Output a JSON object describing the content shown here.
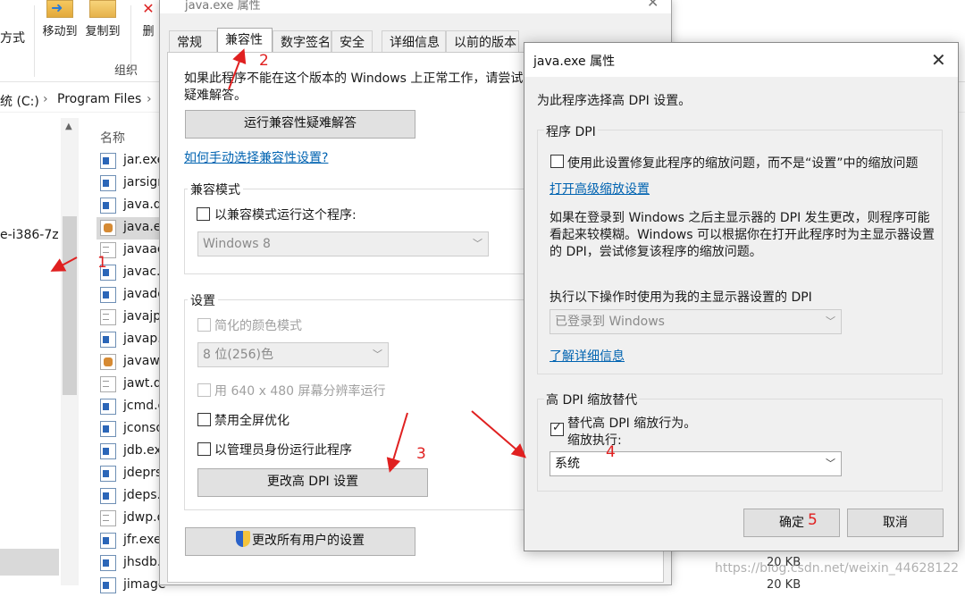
{
  "explorer": {
    "ribbon": {
      "partial_label": "方式",
      "move_to": "移动到",
      "copy_to": "复制到",
      "delete_partial": "删",
      "group": "组织"
    },
    "address": {
      "drive": "统 (C:)",
      "sep": "›",
      "folder": "Program Files",
      "sep2": "›"
    },
    "nav_partial": "e-i386-7z",
    "column_name": "名称",
    "files": [
      {
        "name": "jar.exe",
        "icon": "exe"
      },
      {
        "name": "jarsigner",
        "icon": "exe"
      },
      {
        "name": "java.dll",
        "icon": "exe"
      },
      {
        "name": "java.exe",
        "icon": "java",
        "selected": true
      },
      {
        "name": "javaaccess",
        "icon": "doc"
      },
      {
        "name": "javac.exe",
        "icon": "exe"
      },
      {
        "name": "javadoc",
        "icon": "exe"
      },
      {
        "name": "javajpeg",
        "icon": "doc"
      },
      {
        "name": "javap.exe",
        "icon": "exe"
      },
      {
        "name": "javaw.exe",
        "icon": "java"
      },
      {
        "name": "jawt.dll",
        "icon": "doc"
      },
      {
        "name": "jcmd.exe",
        "icon": "exe"
      },
      {
        "name": "jconsole",
        "icon": "exe"
      },
      {
        "name": "jdb.exe",
        "icon": "exe"
      },
      {
        "name": "jdeprscan",
        "icon": "exe"
      },
      {
        "name": "jdeps.exe",
        "icon": "exe"
      },
      {
        "name": "jdwp.dll",
        "icon": "doc"
      },
      {
        "name": "jfr.exe",
        "icon": "exe"
      },
      {
        "name": "jhsdb.exe",
        "icon": "exe"
      },
      {
        "name": "jimage",
        "icon": "exe"
      }
    ],
    "sizes": [
      "20 KB",
      "20 KB"
    ]
  },
  "dialog1": {
    "title": "java.exe 属性",
    "tabs": [
      "常规",
      "兼容性",
      "数字签名",
      "安全",
      "详细信息",
      "以前的版本"
    ],
    "active_tab": "兼容性",
    "intro": "如果此程序不能在这个版本的 Windows 上正常工作，请尝试",
    "intro2": "疑难解答。",
    "run_troubleshooter": "运行兼容性疑难解答",
    "manual_link": "如何手动选择兼容性设置?",
    "compat_group": "兼容模式",
    "compat_checkbox": "以兼容模式运行这个程序:",
    "compat_combo": "Windows 8",
    "settings_group": "设置",
    "reduced_color": "简化的颜色模式",
    "color_combo": "8 位(256)色",
    "res_640": "用 640 x 480 屏幕分辨率运行",
    "disable_fullscreen": "禁用全屏优化",
    "run_as_admin": "以管理员身份运行此程序",
    "change_dpi": "更改高 DPI 设置",
    "change_all_users": "更改所有用户的设置"
  },
  "dialog2": {
    "title": "java.exe 属性",
    "heading": "为此程序选择高 DPI 设置。",
    "program_dpi_group": "程序 DPI",
    "program_dpi_checkbox": "使用此设置修复此程序的缩放问题，而不是“设置”中的缩放问题",
    "advanced_link": "打开高级缩放设置",
    "explain1": "如果在登录到 Windows 之后主显示器的 DPI 发生更改，则程序可能",
    "explain2": "看起来较模糊。Windows 可以根据你在打开此程序时为主显示器设置",
    "explain3": "的 DPI，尝试修复该程序的缩放问题。",
    "use_dpi_label": "执行以下操作时使用为我的主显示器设置的 DPI",
    "dpi_combo": "已登录到 Windows",
    "learn_more": "了解详细信息",
    "override_group": "高 DPI 缩放替代",
    "override_checkbox": "替代高 DPI 缩放行为。",
    "scaling_by": "缩放执行:",
    "scaling_combo": "系统",
    "ok": "确定",
    "cancel": "取消"
  },
  "annotations": {
    "n1": "1",
    "n2": "2",
    "n3": "3",
    "n4": "4",
    "n5": "5",
    "color": "#e02020"
  },
  "watermark": "https://blog.csdn.net/weixin_44628122"
}
